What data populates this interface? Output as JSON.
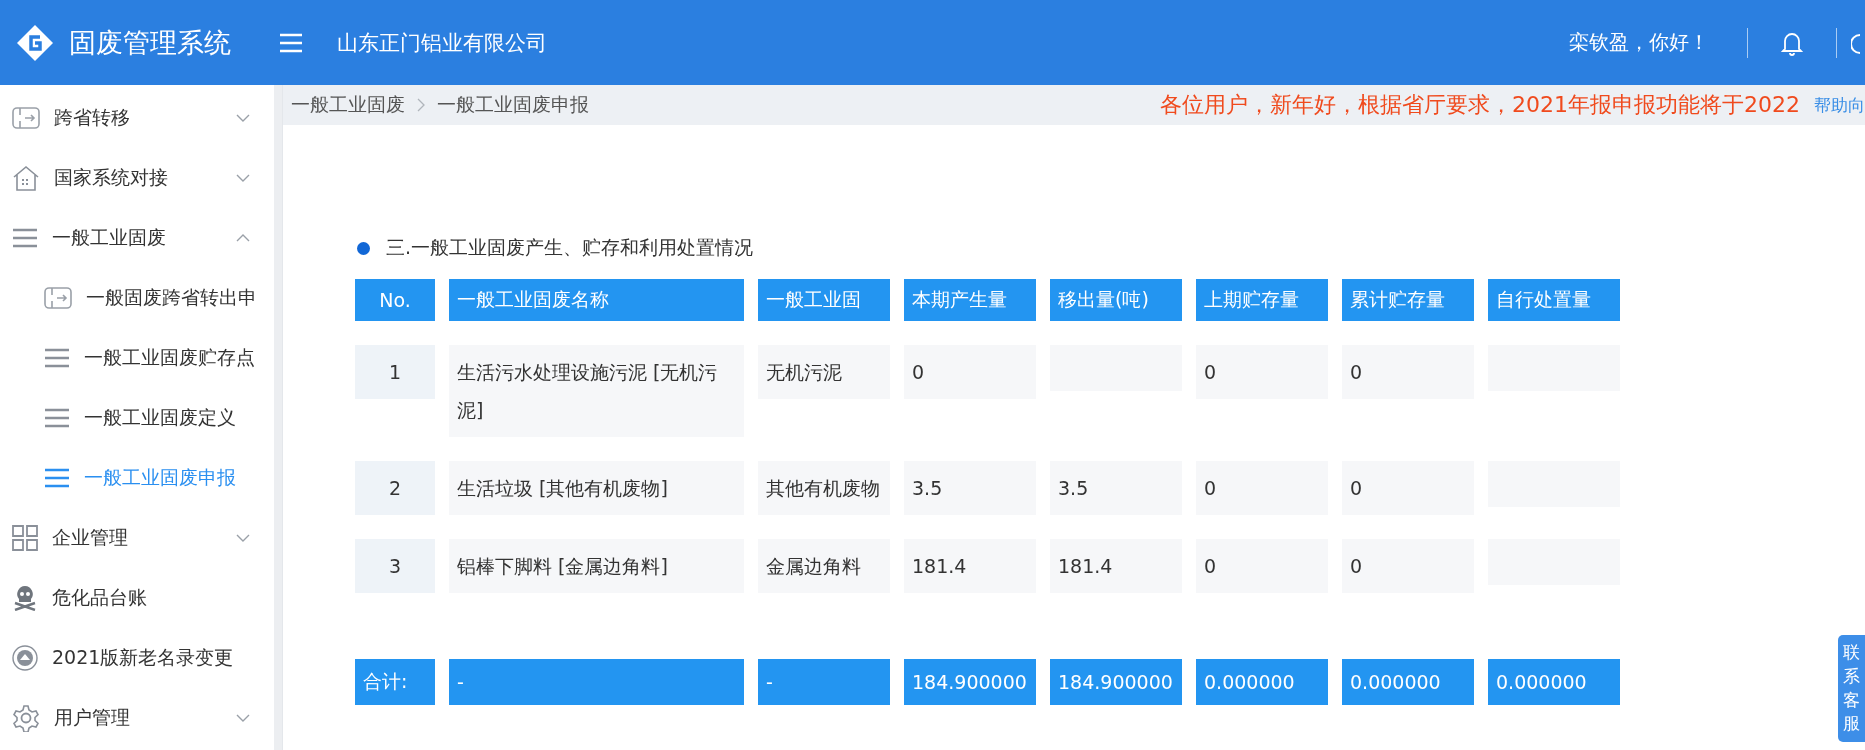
{
  "header": {
    "title": "固废管理系统",
    "company": "山东正门铝业有限公司",
    "greeting": "栾钦盈，你好！"
  },
  "sidebar": {
    "items": [
      {
        "label": "跨省转移",
        "kind": "exit",
        "expanded": false,
        "selected": false
      },
      {
        "label": "国家系统对接",
        "kind": "house",
        "expanded": false,
        "selected": false
      },
      {
        "label": "一般工业固废",
        "kind": "lines",
        "expanded": true,
        "selected": false,
        "children": [
          {
            "label": "一般固废跨省转出申",
            "kind": "exit",
            "selected": false
          },
          {
            "label": "一般工业固废贮存点",
            "kind": "lines",
            "selected": false
          },
          {
            "label": "一般工业固废定义",
            "kind": "lines",
            "selected": false
          },
          {
            "label": "一般工业固废申报",
            "kind": "lines",
            "selected": true
          }
        ]
      },
      {
        "label": "企业管理",
        "kind": "grid",
        "expanded": false,
        "selected": false
      },
      {
        "label": "危化品台账",
        "kind": "skull",
        "selected": false
      },
      {
        "label": "2021版新老名录变更",
        "kind": "emblem",
        "selected": false
      },
      {
        "label": "用户管理",
        "kind": "gear",
        "expanded": false,
        "selected": false
      }
    ]
  },
  "breadcrumb": [
    "一般工业固废",
    "一般工业固废申报"
  ],
  "notice": "各位用户，新年好，根据省厅要求，2021年报申报功能将于2022",
  "help_link": "帮助向",
  "section_title": "三.一般工业固废产生、贮存和利用处置情况",
  "table": {
    "columns": [
      "No.",
      "一般工业固废名称",
      "一般工业固",
      "本期产生量",
      "移出量(吨)",
      "上期贮存量",
      "累计贮存量",
      "自行处置量"
    ],
    "rows": [
      [
        "1",
        "生活污水处理设施污泥 [无机污泥]",
        "无机污泥",
        "0",
        "",
        "0",
        "0",
        ""
      ],
      [
        "2",
        "生活垃圾 [其他有机废物]",
        "其他有机废物",
        "3.5",
        "3.5",
        "0",
        "0",
        ""
      ],
      [
        "3",
        "铝棒下脚料 [金属边角料]",
        "金属边角料",
        "181.4",
        "181.4",
        "0",
        "0",
        ""
      ]
    ],
    "totals": [
      "合计:",
      "-",
      "-",
      "184.900000",
      "184.900000",
      "0.000000",
      "0.000000",
      "0.000000"
    ]
  },
  "service_tab": "联系客服"
}
